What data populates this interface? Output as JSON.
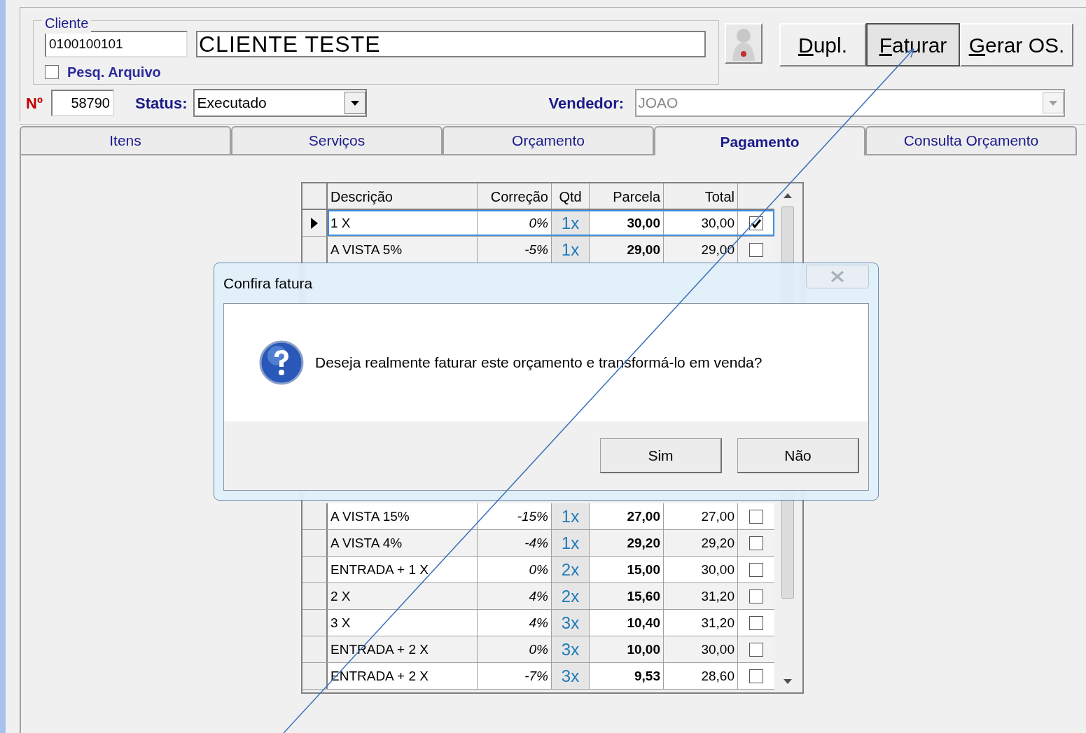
{
  "client": {
    "legend": "Cliente",
    "code": "0100100101",
    "name": "CLIENTE TESTE",
    "search_file": {
      "label": "Pesq. Arquivo",
      "checked": false
    }
  },
  "buttons": [
    {
      "label": "Dupl.",
      "pressed": false
    },
    {
      "label": "Faturar",
      "pressed": true
    },
    {
      "label": "Gerar OS.",
      "pressed": false
    }
  ],
  "number": {
    "label": "Nº",
    "value": "58790"
  },
  "status": {
    "label": "Status:",
    "value": "Executado"
  },
  "seller": {
    "label": "Vendedor:",
    "value": "JOAO",
    "disabled": true
  },
  "tabs": [
    {
      "label": "Itens",
      "selected": false
    },
    {
      "label": "Serviços",
      "selected": false
    },
    {
      "label": "Orçamento",
      "selected": false
    },
    {
      "label": "Pagamento",
      "selected": true
    },
    {
      "label": "Consulta Orçamento",
      "selected": false
    }
  ],
  "grid": {
    "columns": [
      "Descrição",
      "Correção",
      "Qtd",
      "Parcela",
      "Total"
    ],
    "top_rows": [
      {
        "description": "1 X",
        "correction": "0%",
        "qty": "1x",
        "installment": "30,00",
        "total": "30,00",
        "current": true,
        "checked": true
      },
      {
        "description": "A VISTA  5%",
        "correction": "-5%",
        "qty": "1x",
        "installment": "29,00",
        "total": "29,00",
        "current": false,
        "checked": false
      }
    ],
    "bottom_rows": [
      {
        "description": "A VISTA 15%",
        "correction": "-15%",
        "qty": "1x",
        "installment": "27,00",
        "total": "27,00",
        "current": false,
        "checked": false
      },
      {
        "description": "A VISTA 4%",
        "correction": "-4%",
        "qty": "1x",
        "installment": "29,20",
        "total": "29,20",
        "current": false,
        "checked": false
      },
      {
        "description": "ENTRADA + 1 X",
        "correction": "0%",
        "qty": "2x",
        "installment": "15,00",
        "total": "30,00",
        "current": false,
        "checked": false
      },
      {
        "description": "2 X",
        "correction": "4%",
        "qty": "2x",
        "installment": "15,60",
        "total": "31,20",
        "current": false,
        "checked": false
      },
      {
        "description": "3 X",
        "correction": "4%",
        "qty": "3x",
        "installment": "10,40",
        "total": "31,20",
        "current": false,
        "checked": false
      },
      {
        "description": "ENTRADA + 2 X",
        "correction": "0%",
        "qty": "3x",
        "installment": "10,00",
        "total": "30,00",
        "current": false,
        "checked": false
      },
      {
        "description": "ENTRADA + 2 X",
        "correction": "-7%",
        "qty": "3x",
        "installment": "9,53",
        "total": "28,60",
        "current": false,
        "checked": false
      }
    ]
  },
  "dialog": {
    "title": "Confira fatura",
    "message": "Deseja realmente faturar este orçamento e transformá-lo em venda?",
    "buttons": [
      "Sim",
      "Não"
    ]
  }
}
